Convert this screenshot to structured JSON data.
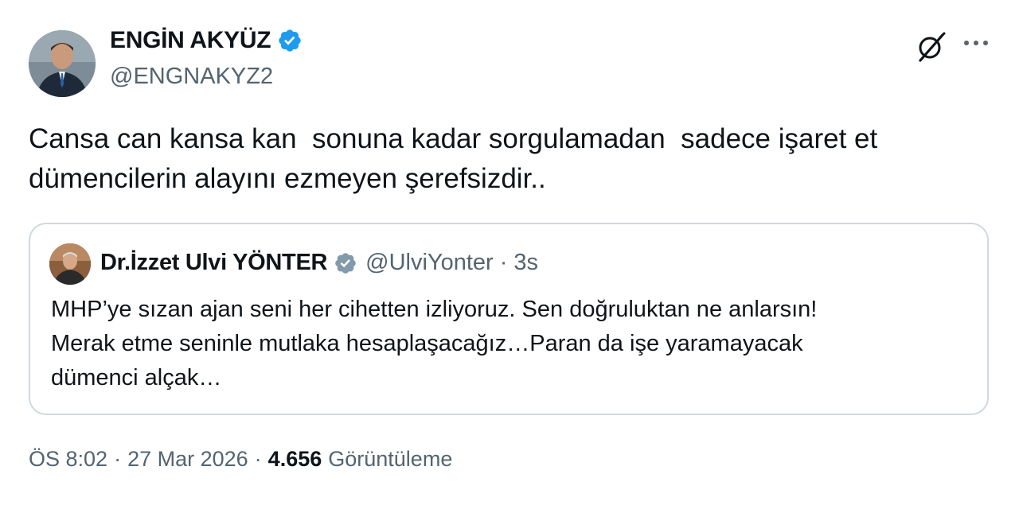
{
  "author": {
    "name": "ENGİN AKYÜZ",
    "handle": "@ENGNAKYZ2",
    "verified_color": "#1d9bf0"
  },
  "header_actions": {
    "grok_icon": "grok-icon",
    "more_icon": "more-horizontal-icon"
  },
  "tweet": {
    "lines": [
      "Cansa can kansa kan  sonuna kadar sorgulamadan  sadece işaret et",
      "dümencilerin alayını ezmeyen şerefsizdir.."
    ]
  },
  "quote": {
    "name": "Dr.İzzet Ulvi YÖNTER",
    "handle": "@UlviYonter",
    "separator": "·",
    "time": "3s",
    "verified_color": "#829aab",
    "lines": [
      "MHP’ye sızan ajan seni her cihetten izliyoruz. Sen doğruluktan ne anlarsın!",
      "Merak etme seninle mutlaka hesaplaşacağız…Paran da işe yaramayacak",
      "dümenci alçak…"
    ]
  },
  "meta": {
    "time": "ÖS 8:02",
    "separator": "·",
    "date": "27 Mar 2026",
    "views_count": "4.656",
    "views_label": "Görüntüleme"
  },
  "colors": {
    "text_primary": "#0f1419",
    "text_secondary": "#536471",
    "border": "#cfd9de"
  }
}
